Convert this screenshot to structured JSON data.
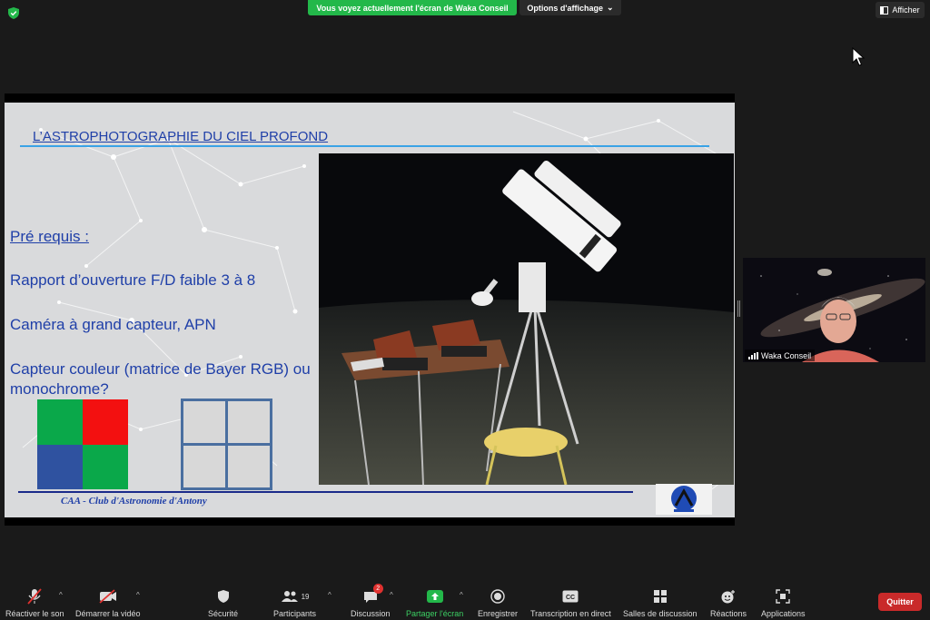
{
  "topbar": {
    "share_banner": "Vous voyez actuellement l'écran de Waka Conseil",
    "view_options": "Options d'affichage",
    "show_label": "Afficher"
  },
  "slide": {
    "title": "L’ASTROPHOTOGRAPHIE DU CIEL PROFOND",
    "prereq": "Pré requis :",
    "bullet1": "Rapport d’ouverture F/D faible 3 à 8",
    "bullet2": "Caméra à grand capteur, APN",
    "bullet3": "Capteur couleur (matrice de Bayer RGB) ou monochrome?",
    "club": "CAA - Club d'Astronomie d'Antony",
    "bayer_colors": [
      "#0aa84a",
      "#f31010",
      "#2f52a0",
      "#0aa84a"
    ]
  },
  "participant": {
    "name": "Waka Conseil"
  },
  "toolbar": {
    "mute": "Réactiver le son",
    "video": "Démarrer la vidéo",
    "security": "Sécurité",
    "participants": "Participants",
    "participants_count": "19",
    "chat": "Discussion",
    "chat_badge": "2",
    "share": "Partager l'écran",
    "record": "Enregistrer",
    "transcript": "Transcription en direct",
    "breakout": "Salles de discussion",
    "reactions": "Réactions",
    "apps": "Applications",
    "quit": "Quitter"
  },
  "colors": {
    "share_green": "#23b84a",
    "quit_red": "#c92a2a",
    "slide_blue": "#1f3fa8"
  }
}
